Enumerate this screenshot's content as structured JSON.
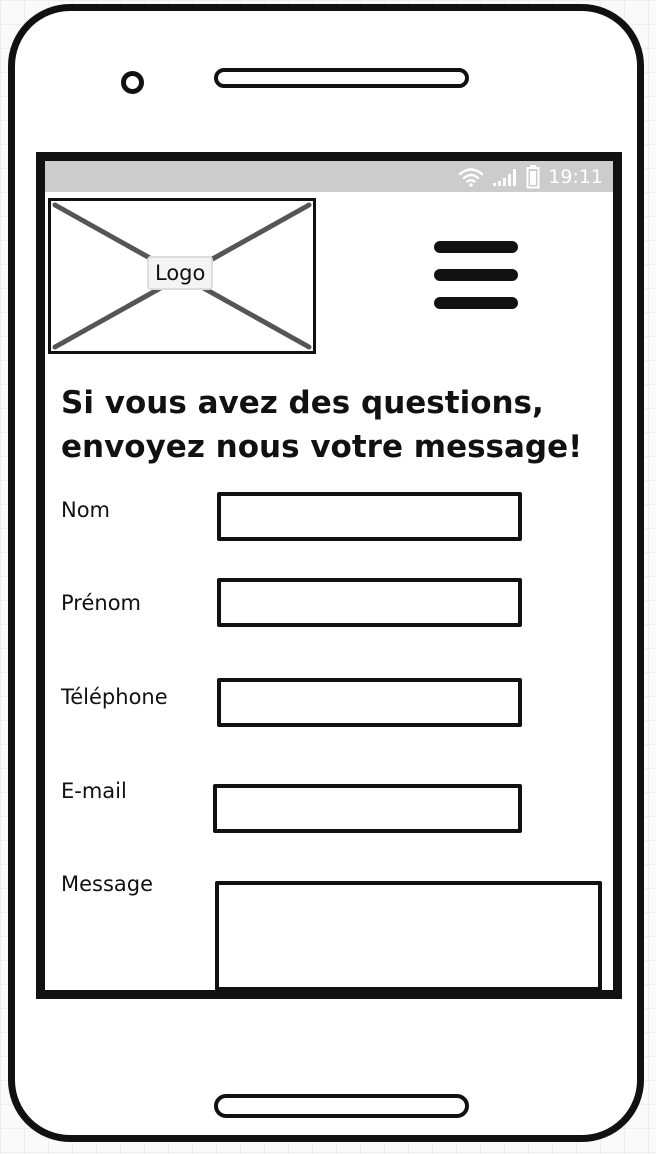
{
  "status_bar": {
    "time": "19:11",
    "icons": [
      "wifi-icon",
      "signal-icon",
      "battery-icon"
    ]
  },
  "header": {
    "logo_label": "Logo",
    "menu_icon": "hamburger-menu-icon"
  },
  "main": {
    "headline": "Si vous avez des questions, envoyez nous votre message!"
  },
  "form": {
    "fields": [
      {
        "label": "Nom",
        "value": "",
        "placeholder": ""
      },
      {
        "label": "Prénom",
        "value": "",
        "placeholder": ""
      },
      {
        "label": "Téléphone",
        "value": "",
        "placeholder": ""
      },
      {
        "label": "E-mail",
        "value": "",
        "placeholder": ""
      },
      {
        "label": "Message",
        "value": "",
        "placeholder": ""
      }
    ]
  },
  "colors": {
    "outline": "#111111",
    "status_bar": "#cccccc",
    "status_text": "#ffffff",
    "placeholder_cross": "#555555"
  }
}
